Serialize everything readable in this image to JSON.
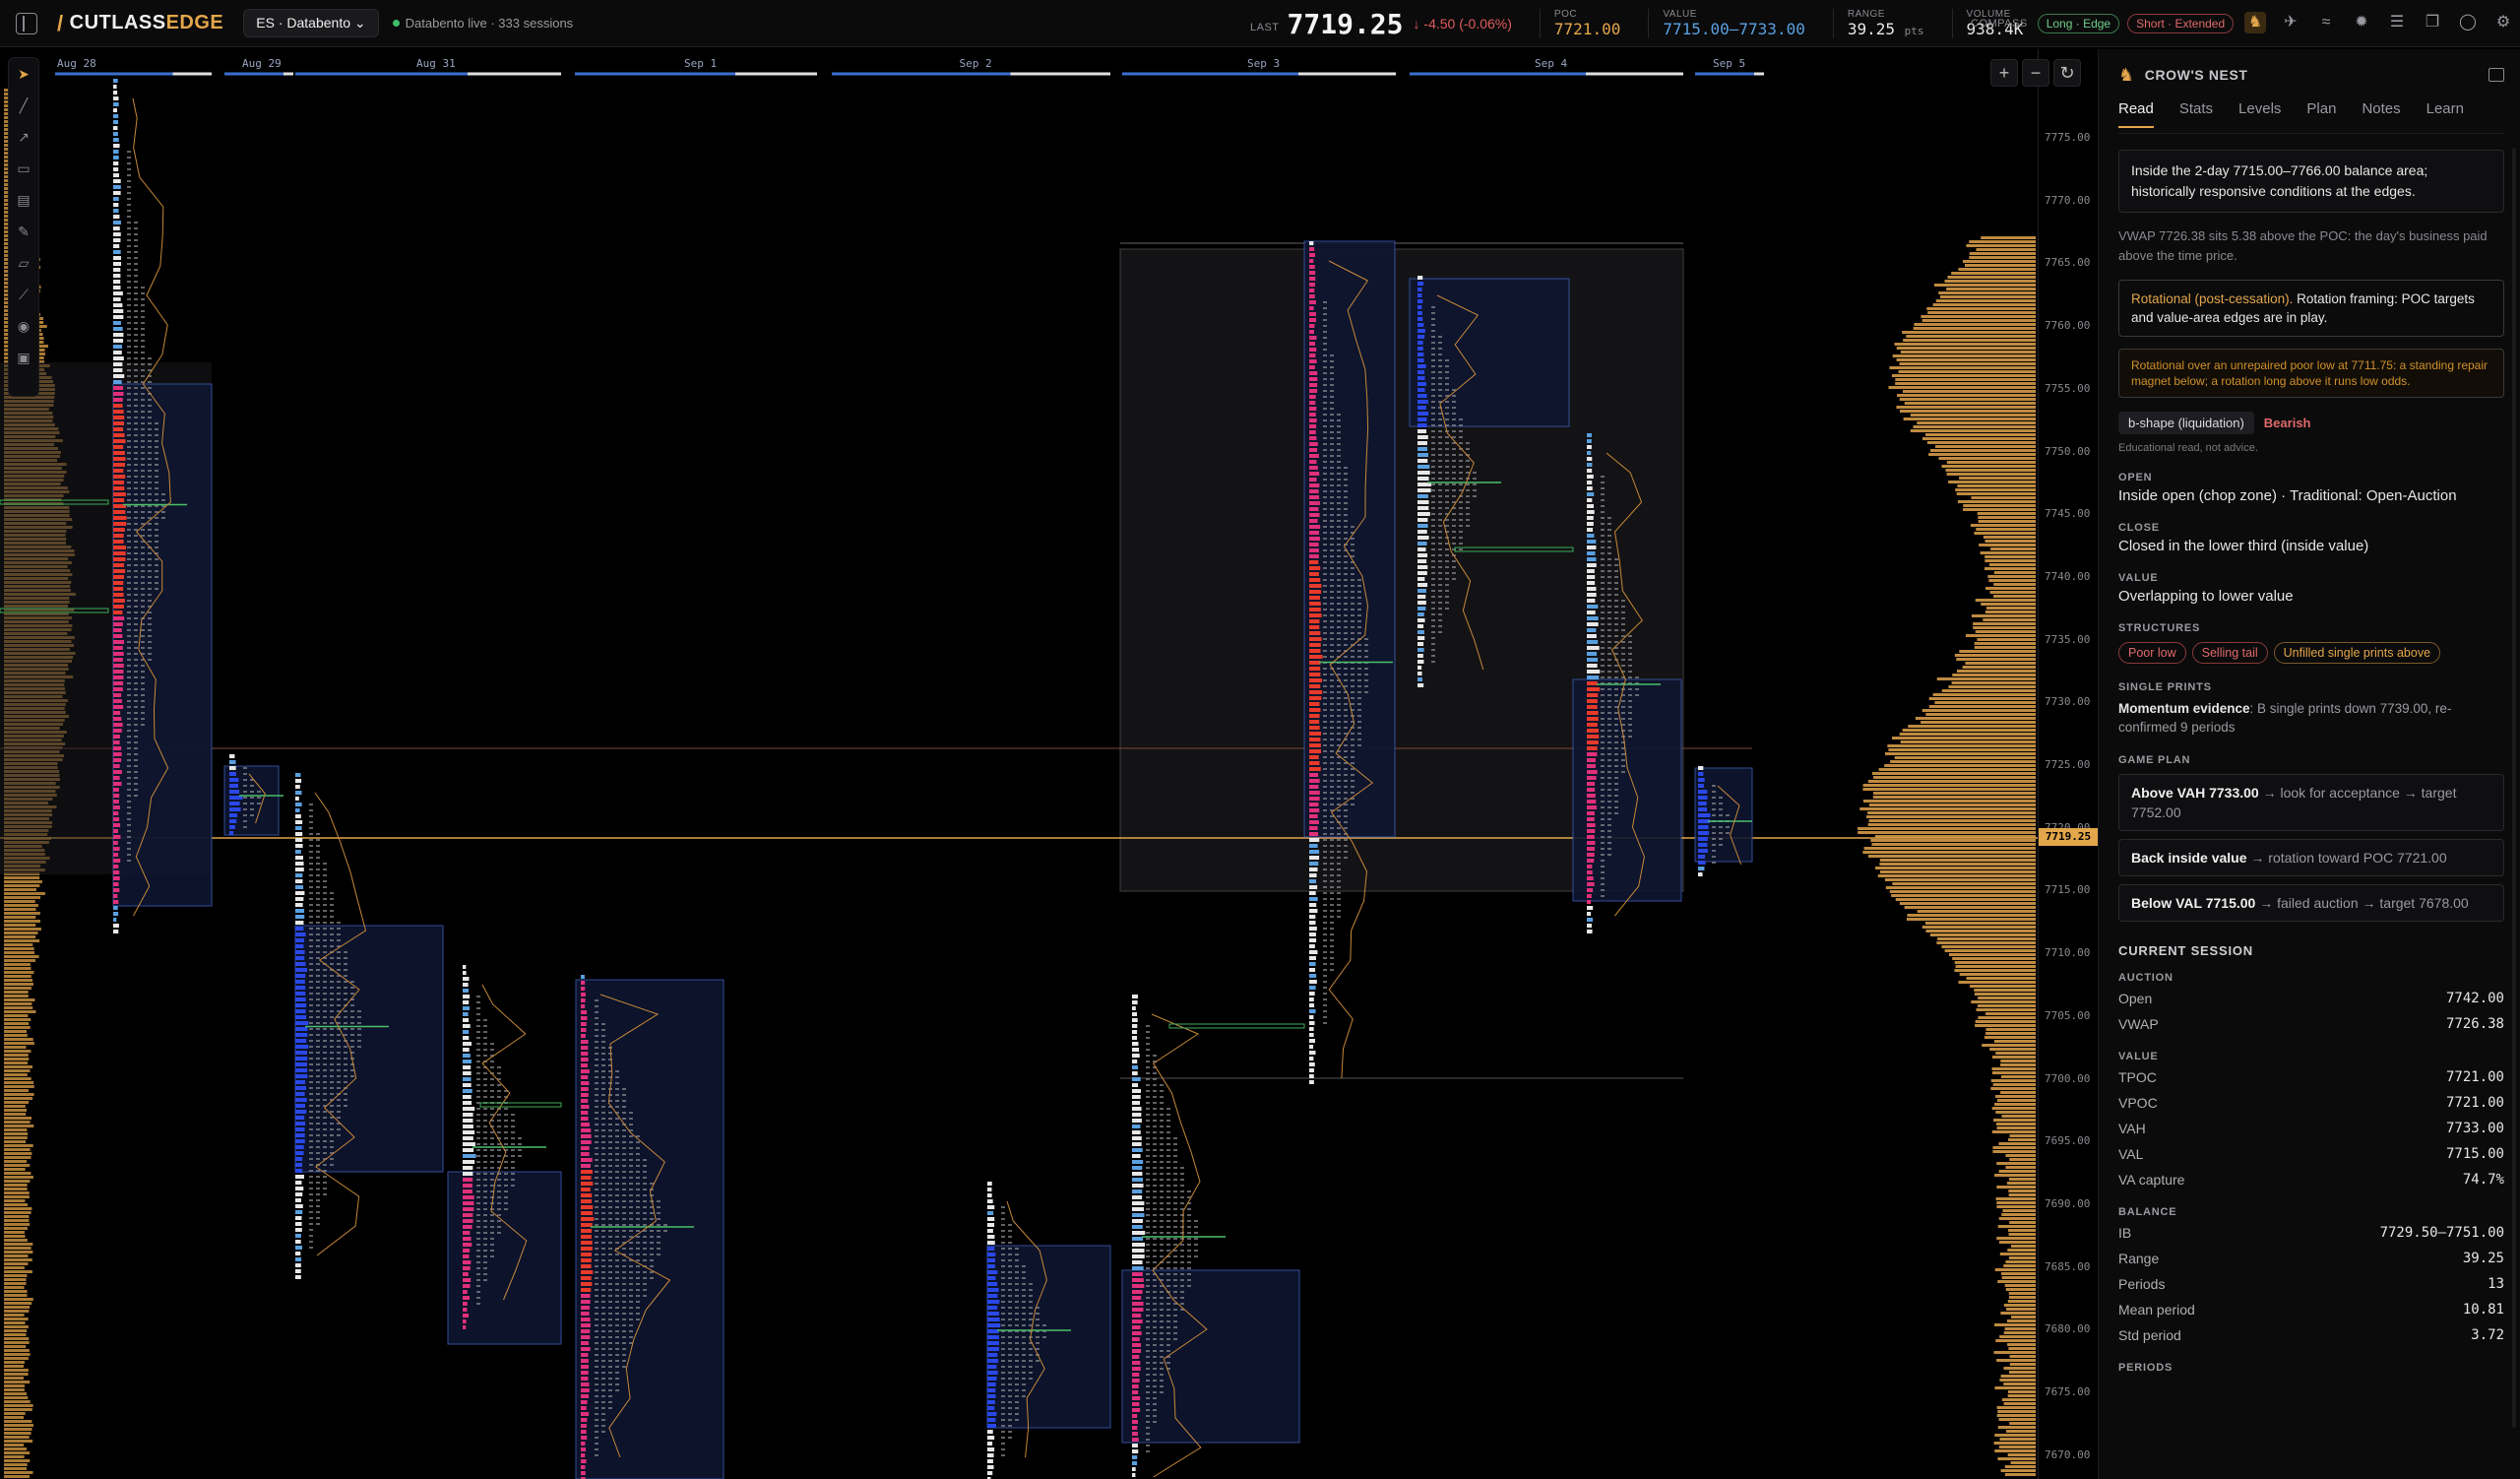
{
  "app": {
    "brand_a": "CUTLASS",
    "brand_b": "EDGE",
    "symbol": "ES · Databento",
    "status": "Databento live · 333 sessions"
  },
  "quote": {
    "last_label": "LAST",
    "last": "7719.25",
    "change": "↓ -4.50 (-0.06%)",
    "poc_label": "POC",
    "poc": "7721.00",
    "value_label": "VALUE",
    "value": "7715.00–7733.00",
    "range_label": "RANGE",
    "range": "39.25",
    "range_unit": "pts",
    "volume_label": "VOLUME",
    "volume": "938.4K"
  },
  "compass": {
    "label": "COMPASS",
    "long": "Long · Edge",
    "short": "Short · Extended"
  },
  "dates": [
    "Aug 28",
    "Aug 29",
    "Aug 31",
    "Sep 1",
    "Sep 2",
    "Sep 3",
    "Sep 4",
    "Sep 5"
  ],
  "y_labels": [
    "7775.00",
    "7770.00",
    "7765.00",
    "7760.00",
    "7755.00",
    "7750.00",
    "7745.00",
    "7740.00",
    "7735.00",
    "7730.00",
    "7725.00",
    "7720.00",
    "7715.00",
    "7710.00",
    "7705.00",
    "7700.00",
    "7695.00",
    "7690.00",
    "7685.00",
    "7680.00",
    "7675.00",
    "7670.00"
  ],
  "current_price": "7719.25",
  "panel": {
    "title": "CROW'S NEST",
    "tabs": [
      "Read",
      "Stats",
      "Levels",
      "Plan",
      "Notes",
      "Learn"
    ],
    "read1": "Inside the 2-day 7715.00–7766.00 balance area; historically responsive conditions at the edges.",
    "vwap_note": "VWAP 7726.38 sits 5.38 above the POC: the day's business paid above the time price.",
    "rot_a": "Rotational (post-cessation).",
    "rot_b": " Rotation framing: POC targets and value-area edges are in play.",
    "warn": "Rotational over an unrepaired poor low at 7711.75: a standing repair magnet below; a rotation long above it runs low odds.",
    "shape": "b-shape (liquidation)",
    "bias": "Bearish",
    "edu": "Educational read, not advice.",
    "open_l": "OPEN",
    "open_v": "Inside open (chop zone) · Traditional: Open-Auction",
    "close_l": "CLOSE",
    "close_v": "Closed in the lower third (inside value)",
    "value_l": "VALUE",
    "value_v": "Overlapping to lower value",
    "struct_l": "STRUCTURES",
    "struct": [
      "Poor low",
      "Selling tail",
      "Unfilled single prints above"
    ],
    "sp_l": "SINGLE PRINTS",
    "sp_b": "Momentum evidence",
    "sp_t": ": B single prints down 7739.00, re-confirmed 9 periods",
    "gp_l": "GAME PLAN",
    "gp1_b": "Above VAH 7733.00",
    "gp1_t": " → look for acceptance → target 7752.00",
    "gp2_b": "Back inside value",
    "gp2_t": " → rotation toward POC 7721.00",
    "gp3_b": "Below VAL 7715.00",
    "gp3_t": " → failed auction → target 7678.00",
    "cs": "CURRENT SESSION",
    "auction_l": "AUCTION",
    "auction": [
      [
        "Open",
        "7742.00"
      ],
      [
        "VWAP",
        "7726.38"
      ]
    ],
    "value2_l": "VALUE",
    "value2": [
      [
        "TPOC",
        "7721.00"
      ],
      [
        "VPOC",
        "7721.00"
      ],
      [
        "VAH",
        "7733.00"
      ],
      [
        "VAL",
        "7715.00"
      ],
      [
        "VA capture",
        "74.7%"
      ]
    ],
    "balance_l": "BALANCE",
    "balance": [
      [
        "IB",
        "7729.50–7751.00"
      ],
      [
        "Range",
        "39.25"
      ],
      [
        "Periods",
        "13"
      ],
      [
        "Mean period",
        "10.81"
      ],
      [
        "Std period",
        "3.72"
      ]
    ],
    "periods_l": "PERIODS"
  }
}
